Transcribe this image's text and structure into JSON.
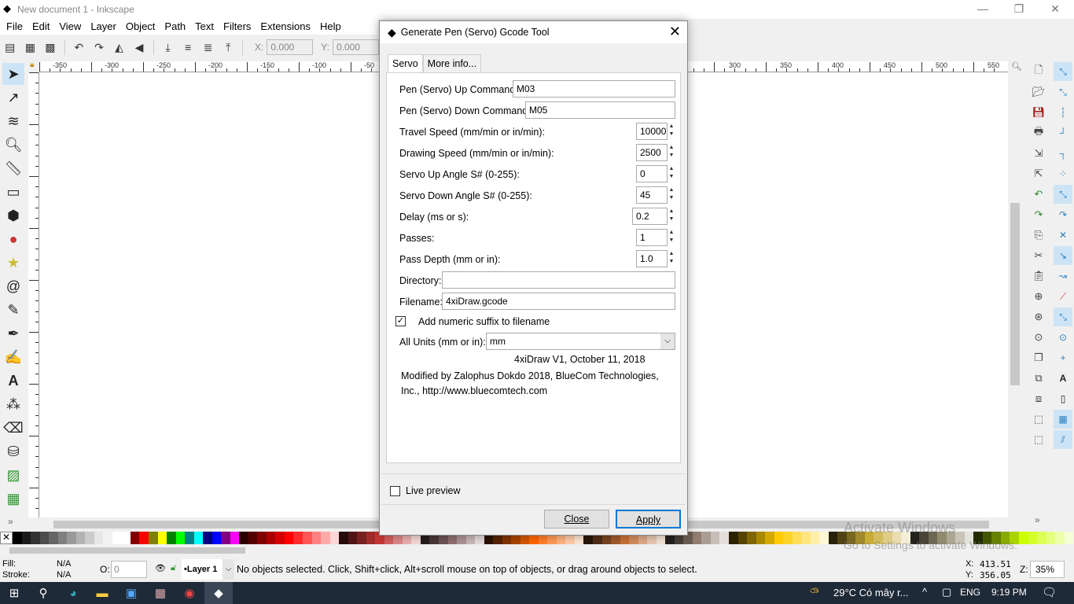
{
  "window": {
    "title": "New document 1 - Inkscape",
    "min": "—",
    "max": "❐",
    "close": "✕"
  },
  "menu": [
    "File",
    "Edit",
    "View",
    "Layer",
    "Object",
    "Path",
    "Text",
    "Filters",
    "Extensions",
    "Help"
  ],
  "toolbar": {
    "x_label": "X:",
    "x_value": "0.000",
    "y_label": "Y:",
    "y_value": "0.000"
  },
  "ruler": {
    "top_ticks": [
      "-350",
      "-300",
      "-250",
      "-200",
      "-150",
      "-100",
      "-50",
      "300",
      "350",
      "400",
      "450",
      "500",
      "550"
    ]
  },
  "dialog": {
    "title": "Generate Pen (Servo) Gcode Tool",
    "tabs": [
      "Servo",
      "More info..."
    ],
    "fields": {
      "pen_up_label": "Pen (Servo) Up Command:",
      "pen_up_value": "M03",
      "pen_down_label": "Pen (Servo) Down Command:",
      "pen_down_value": "M05",
      "travel_label": "Travel Speed (mm/min or in/min):",
      "travel_value": "10000",
      "drawing_label": "Drawing Speed (mm/min or in/min):",
      "drawing_value": "2500",
      "servo_up_label": "Servo Up Angle S# (0-255):",
      "servo_up_value": "0",
      "servo_down_label": "Servo Down Angle S# (0-255):",
      "servo_down_value": "45",
      "delay_label": "Delay (ms or s):",
      "delay_value": "0.2",
      "passes_label": "Passes:",
      "passes_value": "1",
      "depth_label": "Pass Depth (mm or in):",
      "depth_value": "1.0",
      "directory_label": "Directory:",
      "directory_value": "",
      "filename_label": "Filename:",
      "filename_value": "4xiDraw.gcode",
      "suffix_label": "Add numeric suffix to filename",
      "suffix_checked": true,
      "units_label": "All Units (mm or in):",
      "units_value": "mm"
    },
    "version": "4xiDraw V1, October 11, 2018",
    "credit": "Modified by Zalophus Dokdo 2018, BlueCom Technologies, Inc., http://www.bluecomtech.com",
    "live_preview": "Live preview",
    "close": "Close",
    "apply": "Apply"
  },
  "palette": [
    "#000000",
    "#1a1a1a",
    "#333333",
    "#4d4d4d",
    "#666666",
    "#808080",
    "#999999",
    "#b3b3b3",
    "#cccccc",
    "#e6e6e6",
    "#f2f2f2",
    "#ffffff",
    "#ffffff",
    "#800000",
    "#ff0000",
    "#808000",
    "#ffff00",
    "#008000",
    "#00ff00",
    "#008080",
    "#00ffff",
    "#000080",
    "#0000ff",
    "#800080",
    "#ff00ff",
    "#2b0000",
    "#550000",
    "#800000",
    "#aa0000",
    "#d40000",
    "#ff0000",
    "#ff2a2a",
    "#ff5555",
    "#ff8080",
    "#ffaaaa",
    "#ffd5d5",
    "#280b0b",
    "#501616",
    "#782121",
    "#a02c2c",
    "#c83737",
    "#d35f5f",
    "#de8787",
    "#e9afaf",
    "#f4d7d7",
    "#241c1c",
    "#483737",
    "#6c5353",
    "#916f6f",
    "#ac9393",
    "#c8b7b7",
    "#e3dbdb",
    "#2b1100",
    "#552200",
    "#803300",
    "#aa4400",
    "#d45500",
    "#ff6600",
    "#ff7f2a",
    "#ff9955",
    "#ffb380",
    "#ffccaa",
    "#ffe6d5",
    "#28170b",
    "#502d16",
    "#784421",
    "#a05a2c",
    "#c87137",
    "#d38d5f",
    "#deaa87",
    "#e9c6af",
    "#f4e3d7",
    "#241f1c",
    "#483e37",
    "#6c5d53",
    "#917c6f",
    "#ac9d93",
    "#c8beb7",
    "#e3dedb",
    "#2b2200",
    "#554400",
    "#806600",
    "#aa8800",
    "#d4aa00",
    "#ffcc00",
    "#ffd42a",
    "#ffdd55",
    "#ffe680",
    "#ffeeaa",
    "#fff6d5",
    "#28220b",
    "#504416",
    "#786721",
    "#a0892c",
    "#c8ab37",
    "#d3bc5f",
    "#decd87",
    "#e9ddaf",
    "#f4eed7",
    "#24221c",
    "#484537",
    "#6c6753",
    "#918a6f",
    "#aca793",
    "#c8c4b7",
    "#e3e2db",
    "#222b00",
    "#445500",
    "#668000",
    "#88aa00",
    "#aad400",
    "#ccff00",
    "#d4ff2a",
    "#ddff55",
    "#e5ff80",
    "#eeffaa",
    "#f6ffd5"
  ],
  "status": {
    "fill_label": "Fill:",
    "fill_value": "N/A",
    "stroke_label": "Stroke:",
    "stroke_value": "N/A",
    "opacity_label": "O:",
    "opacity_value": "0",
    "layer": "•Layer 1",
    "message": "No objects selected. Click, Shift+click, Alt+scroll mouse on top of objects, or drag around objects to select.",
    "cursor_x_label": "X:",
    "cursor_x": "413.51",
    "cursor_y_label": "Y:",
    "cursor_y": "356.05",
    "zoom_label": "Z:",
    "zoom": "35%"
  },
  "watermark": {
    "line1": "Activate Windows",
    "line2": "Go to Settings to activate Windows."
  },
  "taskbar": {
    "weather": "29°C  Có mây r...",
    "lang": "ENG",
    "time": "9:19 PM"
  }
}
